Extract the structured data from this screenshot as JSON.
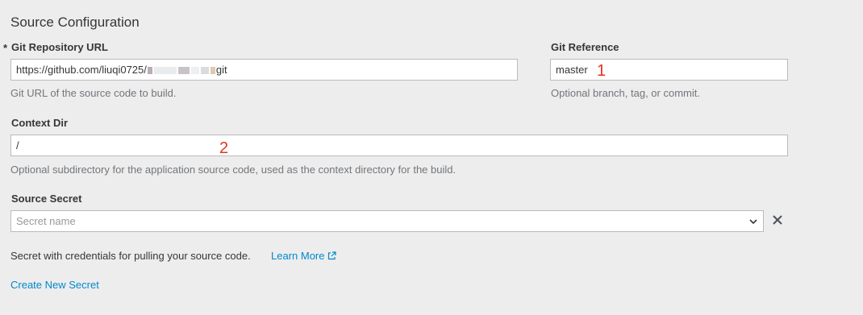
{
  "section": {
    "title": "Source Configuration"
  },
  "git_url": {
    "required_marker": "*",
    "label": "Git Repository URL",
    "value_prefix": "https://github.com/liuqi0725/",
    "value_suffix": "git",
    "help": "Git URL of the source code to build."
  },
  "git_ref": {
    "label": "Git Reference",
    "value": "master",
    "help": "Optional branch, tag, or commit."
  },
  "context_dir": {
    "label": "Context Dir",
    "value": "/",
    "help": "Optional subdirectory for the application source code, used as the context directory for the build."
  },
  "source_secret": {
    "label": "Source Secret",
    "placeholder": "Secret name",
    "help": "Secret with credentials for pulling your source code.",
    "learn_more": "Learn More",
    "create_link": "Create New Secret"
  },
  "annotations": {
    "one": "1",
    "two": "2"
  },
  "colors": {
    "link": "#0088ce",
    "annotation": "#e0341f",
    "background": "#ededed"
  },
  "icons": {
    "dropdown": "chevron-down-icon",
    "clear": "close-icon",
    "external": "external-link-icon"
  }
}
